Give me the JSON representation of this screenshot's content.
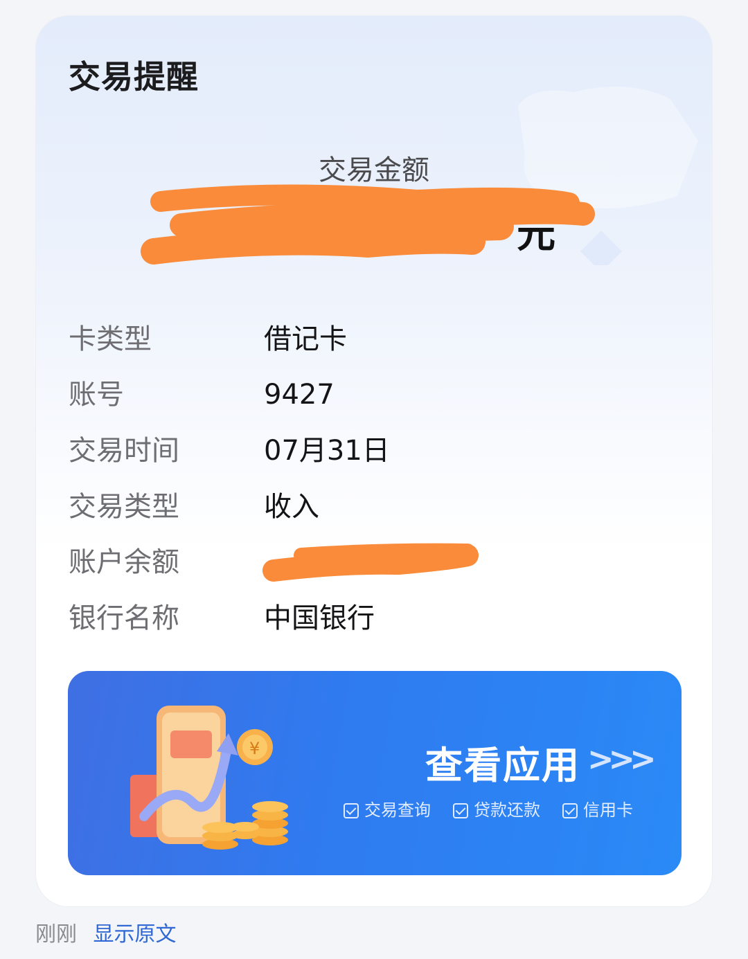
{
  "card": {
    "title": "交易提醒",
    "amount_label": "交易金额",
    "amount_unit": "元",
    "rows": [
      {
        "label": "卡类型",
        "value": "借记卡"
      },
      {
        "label": "账号",
        "value": "9427"
      },
      {
        "label": "交易时间",
        "value": "07月31日"
      },
      {
        "label": "交易类型",
        "value": "收入"
      },
      {
        "label": "账户余额",
        "value": ""
      },
      {
        "label": "银行名称",
        "value": "中国银行"
      }
    ]
  },
  "banner": {
    "title": "查看应用",
    "arrow": ">>>",
    "features": [
      "交易查询",
      "贷款还款",
      "信用卡"
    ]
  },
  "footer": {
    "time": "刚刚",
    "show_original": "显示原文"
  },
  "colors": {
    "redaction": "#f98b3a",
    "banner": "#2f7bf0",
    "link": "#2f68d4"
  }
}
